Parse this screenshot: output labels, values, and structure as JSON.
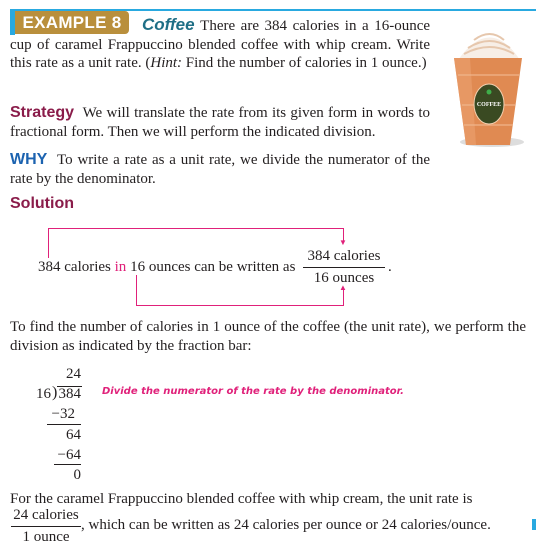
{
  "example": {
    "badge": "EXAMPLE 8",
    "title": "Coffee",
    "problem": "There are 384 calories in a 16-ounce cup of caramel Frappuccino blended coffee with whip cream. Write this rate as a unit rate. (",
    "hint_label": "Hint:",
    "hint_text": " Find the number of calories in 1 ounce.)",
    "image": {
      "name": "frappuccino-cup",
      "logo_text": "WORLD'S COFFEE SHOP"
    }
  },
  "strategy": {
    "label": "Strategy",
    "text": "We will translate the rate from its given form in words to fractional form. Then we will perform the indicated division."
  },
  "why": {
    "label": "WHY",
    "text": "To write a rate as a unit rate, we divide the numerator of the rate by the denominator."
  },
  "solution": {
    "label": "Solution",
    "sentence_a": "384 calories ",
    "sentence_in": "in",
    "sentence_b": " 16 ounces can be written as",
    "fraction_num": "384 calories",
    "fraction_den": "16 ounces",
    "period": ".",
    "intro": "To find the number of calories in 1 ounce of the coffee (the unit rate), we perform the division as indicated by the fraction bar:",
    "division": {
      "quotient": "24",
      "divisor": "16",
      "dividend": "384",
      "steps": [
        "−32",
        "64",
        "−64",
        "0"
      ],
      "note": "Divide the numerator of the rate by the denominator."
    },
    "conclusion_a": "For the caramel Frappuccino blended coffee with whip cream, the unit rate is",
    "result_num": "24 calories",
    "result_den": "1 ounce",
    "conclusion_b": ", which can be written as 24 calories per ounce or 24 calories/ounce."
  },
  "colors": {
    "accent_blue": "#29a9e0",
    "badge_gold": "#b98f3c",
    "highlight_pink": "#e0217a",
    "heading_maroon": "#8a1c4a"
  }
}
